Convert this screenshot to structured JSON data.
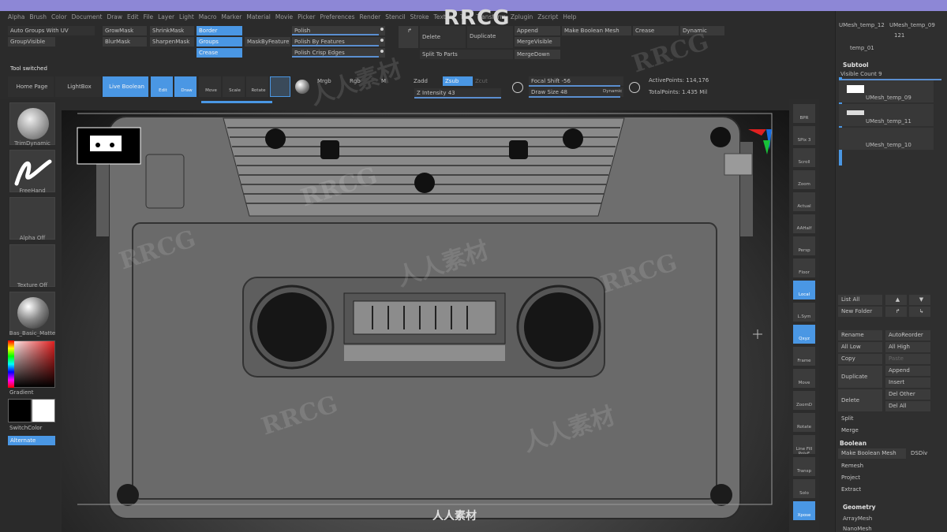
{
  "menu": [
    "Alpha",
    "Brush",
    "Color",
    "Document",
    "Draw",
    "Edit",
    "File",
    "Layer",
    "Light",
    "Macro",
    "Marker",
    "Material",
    "Movie",
    "Picker",
    "Preferences",
    "Render",
    "Stencil",
    "Stroke",
    "Texture",
    "Tool",
    "Transform",
    "Zplugin",
    "Zscript",
    "Help"
  ],
  "brand_logo": "RRCG",
  "top_toolbar": {
    "auto_groups_split": "Auto Groups With UV",
    "group_visible": "GroupVisible",
    "grow_mask": "GrowMask",
    "shrink_mask": "ShrinkMask",
    "blur_mask": "BlurMask",
    "sharpen_mask": "SharpenMask",
    "border": "Border",
    "groups": "Groups",
    "crease": "Crease",
    "mask_by_feature": "MaskByFeature",
    "polish": "Polish",
    "polish_by_features": "Polish By Features",
    "polish_crisp_edges": "Polish Crisp Edges",
    "delete": "Delete",
    "duplicate": "Duplicate",
    "split_to_parts": "Split To Parts",
    "append": "Append",
    "merge_visible": "MergeVisible",
    "merge_down": "MergeDown",
    "make_boolean_mesh": "Make Boolean Mesh",
    "crease2": "Crease",
    "dynamic": "Dynamic"
  },
  "second_toolbar": {
    "tool_switched": "Tool switched",
    "home_page": "Home Page",
    "lightbox": "LightBox",
    "live_boolean": "Live Boolean",
    "edit": "Edit",
    "draw": "Draw",
    "move": "Move",
    "scale": "Scale",
    "rotate": "Rotate",
    "mrgb": "Mrgb",
    "rgb": "Rgb",
    "m": "M",
    "zadd": "Zadd",
    "zsub": "Zsub",
    "zcut": "Zcut",
    "z_intensity": "Z Intensity 43",
    "focal_shift": "Focal Shift -56",
    "draw_size": "Draw Size 48",
    "dynamic": "Dynamic",
    "active_points": "ActivePoints: 114,176",
    "total_points": "TotalPoints: 1.435 Mil"
  },
  "left_shelf": {
    "brush_label": "TrimDynamic",
    "stroke_label": "FreeHand",
    "alpha_label": "Alpha Off",
    "texture_label": "Texture Off",
    "material_label": "Bas_Basic_Matte",
    "gradient": "Gradient",
    "switch_color": "SwitchColor",
    "alternate": "Alternate"
  },
  "right_shelf": [
    "BPR",
    "SPix 3",
    "Scroll",
    "Zoom",
    "Actual",
    "AAHalf",
    "Persp",
    "Floor",
    "Local",
    "L.Sym",
    "Qxyz",
    "Frame",
    "Move",
    "ZoomD",
    "Rotate",
    "Line Fill PolyF",
    "Transp",
    "Solo",
    "Xpose"
  ],
  "right_panel": {
    "subtool_names_top": [
      "UMesh_temp_12",
      "UMesh_temp_09",
      "121",
      "temp_01"
    ],
    "subtool_header": "Subtool",
    "visible_count": "Visible Count 9",
    "subtools": [
      "UMesh_temp_09",
      "UMesh_temp_11",
      "UMesh_temp_10"
    ],
    "list_all": "List All",
    "new_folder": "New Folder",
    "rename": "Rename",
    "auto_reorder": "AutoReorder",
    "all_low": "All Low",
    "all_high": "All High",
    "copy": "Copy",
    "paste": "Paste",
    "duplicate": "Duplicate",
    "append": "Append",
    "insert": "Insert",
    "delete": "Delete",
    "del_other": "Del Other",
    "del_all": "Del All",
    "split": "Split",
    "merge": "Merge",
    "boolean_header": "Boolean",
    "make_boolean_mesh": "Make Boolean Mesh",
    "dsdiv": "DSDiv",
    "remesh": "Remesh",
    "project": "Project",
    "extract": "Extract",
    "geometry_header": "Geometry",
    "array_mesh": "ArrayMesh",
    "nano_mesh": "NanoMesh"
  },
  "watermark": {
    "latin": "RRCG",
    "cjk": "人人素材"
  },
  "bottom_logo": "人人素材"
}
